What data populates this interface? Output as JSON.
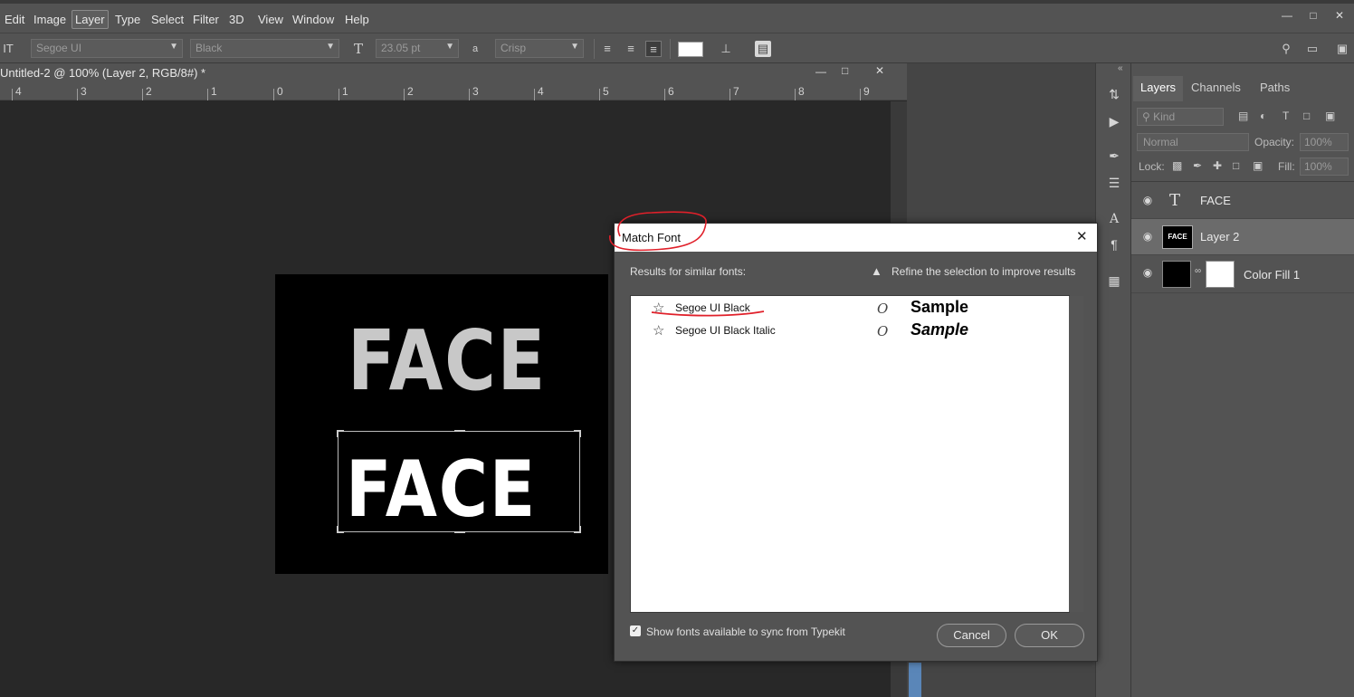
{
  "menubar": {
    "items": [
      "Edit",
      "Image",
      "Layer",
      "Type",
      "Select",
      "Filter",
      "3D",
      "View",
      "Window",
      "Help"
    ],
    "active": "Layer"
  },
  "options": {
    "font_family": "Segoe UI",
    "font_style": "Black",
    "font_size": "23.05 pt",
    "antialias": "Crisp",
    "aa_glyph": "a",
    "text_color": "#ffffff"
  },
  "document": {
    "title": "Untitled-2 @ 100% (Layer 2, RGB/8#) *",
    "ruler_labels": [
      "4",
      "3",
      "2",
      "1",
      "0",
      "1",
      "2",
      "3",
      "4",
      "5",
      "6",
      "7",
      "8",
      "9"
    ],
    "canvas_text_top": "FACE",
    "canvas_text_bottom": "FACE"
  },
  "layers_panel": {
    "tabs": [
      "Layers",
      "Channels",
      "Paths"
    ],
    "active_tab": "Layers",
    "kind_filter": "Kind",
    "blend_mode": "Normal",
    "opacity_label": "Opacity:",
    "opacity_value": "100%",
    "lock_label": "Lock:",
    "fill_label": "Fill:",
    "fill_value": "100%",
    "layers": [
      {
        "name": "FACE",
        "type": "text",
        "selected": false
      },
      {
        "name": "Layer 2",
        "type": "raster",
        "thumb_text": "FACE",
        "selected": true
      },
      {
        "name": "Color Fill 1",
        "type": "fill",
        "selected": false
      }
    ]
  },
  "dialog": {
    "title": "Match Font",
    "results_label": "Results for similar fonts:",
    "hint": "Refine the selection to improve results",
    "results": [
      {
        "name": "Segoe UI Black",
        "type_glyph": "O",
        "sample": "Sample",
        "italic": false
      },
      {
        "name": "Segoe UI Black Italic",
        "type_glyph": "O",
        "sample": "Sample",
        "italic": true
      }
    ],
    "typekit_label": "Show fonts available to sync from Typekit",
    "typekit_checked": true,
    "cancel_label": "Cancel",
    "ok_label": "OK"
  },
  "colors": {
    "panel_bg": "#535353",
    "canvas_bg": "#282828",
    "annotation_red": "#e0202a"
  }
}
